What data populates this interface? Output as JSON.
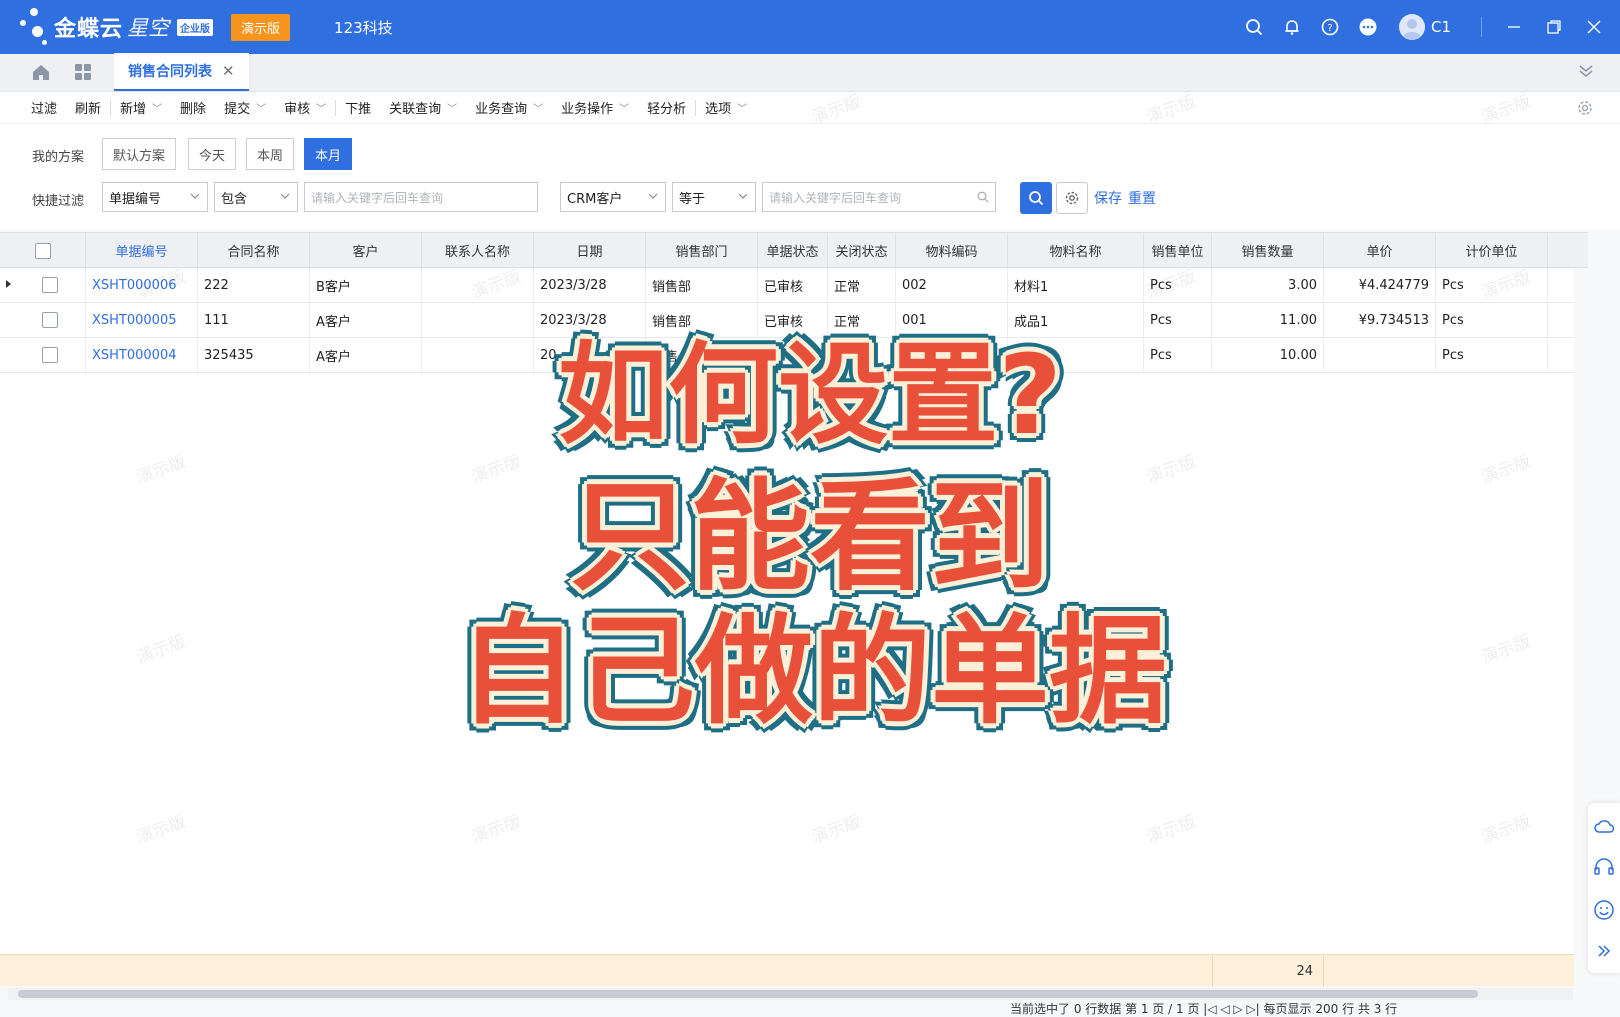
{
  "titlebar": {
    "brand": "金蝶云",
    "brand2": "星空",
    "edition": "企业版",
    "demo_badge": "演示版",
    "company": "123科技",
    "user": "C1"
  },
  "tabs": [
    {
      "label": "销售合同列表",
      "close": "✕"
    }
  ],
  "toolbar": {
    "items": [
      {
        "label": "过滤",
        "caret": false
      },
      {
        "label": "刷新",
        "caret": false
      },
      {
        "label": "新增",
        "caret": true
      },
      {
        "label": "删除",
        "caret": false
      },
      {
        "label": "提交",
        "caret": true
      },
      {
        "label": "审核",
        "caret": true
      },
      {
        "label": "下推",
        "caret": false
      },
      {
        "label": "关联查询",
        "caret": true
      },
      {
        "label": "业务查询",
        "caret": true
      },
      {
        "label": "业务操作",
        "caret": true
      },
      {
        "label": "轻分析",
        "caret": false
      },
      {
        "label": "选项",
        "caret": true
      }
    ]
  },
  "filters": {
    "scheme_label": "我的方案",
    "schemes": [
      "默认方案",
      "今天",
      "本周",
      "本月"
    ],
    "active_scheme": "本月",
    "quick_label": "快捷过滤",
    "field1": "单据编号",
    "op1": "包含",
    "placeholder1": "请输入关键字后回车查询",
    "field2": "CRM客户",
    "op2": "等于",
    "placeholder2": "请输入关键字后回车查询",
    "save": "保存",
    "reset": "重置"
  },
  "table": {
    "columns": [
      "单据编号",
      "合同名称",
      "客户",
      "联系人名称",
      "日期",
      "销售部门",
      "单据状态",
      "关闭状态",
      "物料编码",
      "物料名称",
      "销售单位",
      "销售数量",
      "单价",
      "计价单位"
    ],
    "rows": [
      [
        "XSHT000006",
        "222",
        "B客户",
        "",
        "2023/3/28",
        "销售部",
        "已审核",
        "正常",
        "002",
        "材料1",
        "Pcs",
        "3.00",
        "¥4.424779",
        "Pcs"
      ],
      [
        "XSHT000005",
        "111",
        "A客户",
        "",
        "2023/3/28",
        "销售部",
        "已审核",
        "正常",
        "001",
        "成品1",
        "Pcs",
        "11.00",
        "¥9.734513",
        "Pcs"
      ],
      [
        "XSHT000004",
        "325435",
        "A客户",
        "",
        "20",
        "销售",
        "",
        "",
        "300",
        "",
        "Pcs",
        "10.00",
        "",
        "Pcs"
      ]
    ],
    "sum_quantity": "24"
  },
  "pager": {
    "text": "当前选中了 0 行数据    第    1  页 / 1 页    |◁  ◁  ▷  ▷|    每页显示    200    行 共 3 行"
  },
  "watermark": "演示版",
  "overlay": {
    "line1": "如何设置?",
    "line2": "只能看到",
    "line3": "自己做的单据"
  }
}
